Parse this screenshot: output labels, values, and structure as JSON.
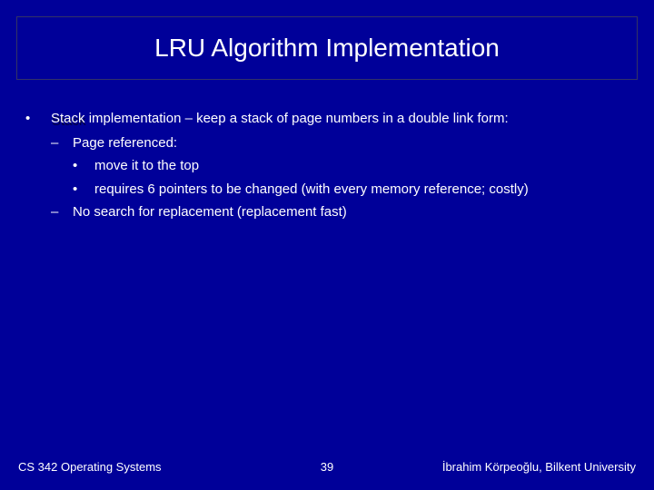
{
  "title": "LRU Algorithm Implementation",
  "content": {
    "l1_marker": "•",
    "l1_stack": "Stack",
    "l1_text": " implementation – keep a stack of page numbers in a double link form:",
    "l2a_marker": "–",
    "l2a_text": "Page referenced:",
    "l3a_marker": "•",
    "l3a_text": "move it to the top",
    "l3b_marker": "•",
    "l3b_text": "requires 6 pointers to be changed (with every memory reference; costly)",
    "l2b_marker": "–",
    "l2b_text": "No search for replacement (replacement fast)"
  },
  "footer": {
    "left": "CS 342 Operating Systems",
    "center": "39",
    "right": "İbrahim Körpeoğlu, Bilkent University"
  }
}
